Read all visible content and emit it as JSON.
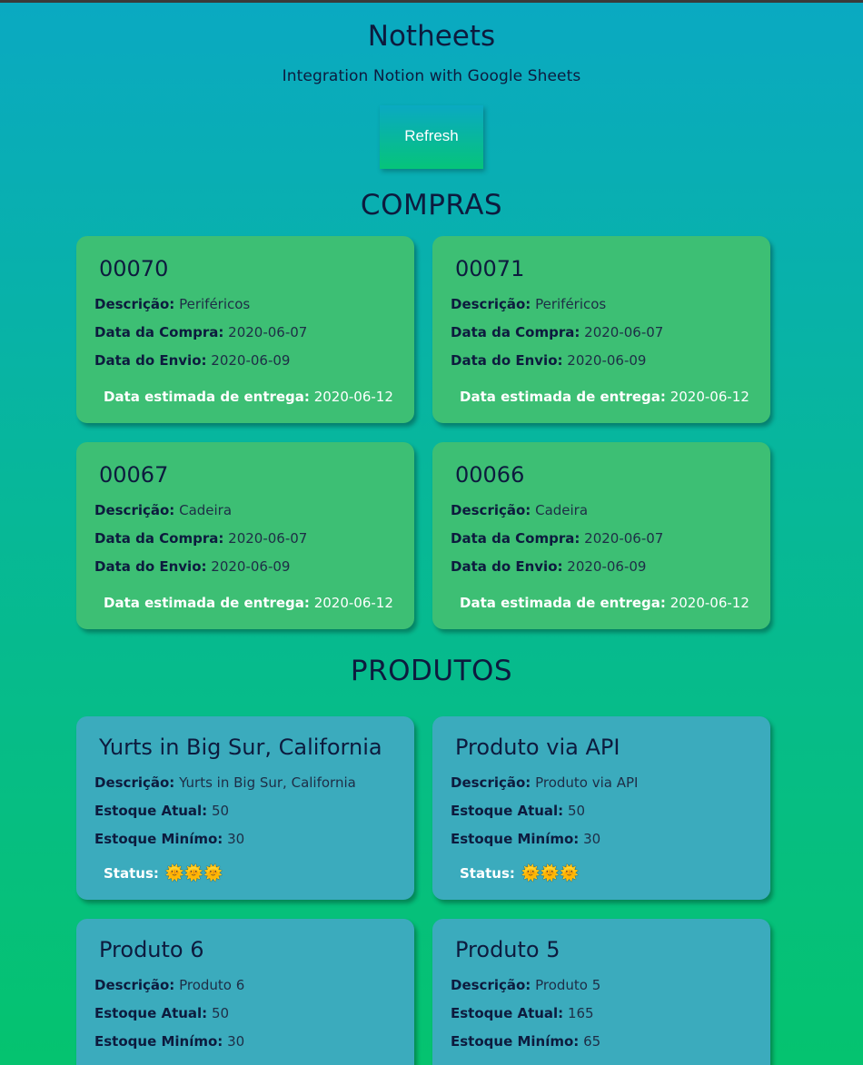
{
  "header": {
    "title": "Notheets",
    "subtitle": "Integration Notion with Google Sheets",
    "refresh_label": "Refresh"
  },
  "compras": {
    "title": "COMPRAS",
    "labels": {
      "descricao": "Descrição:",
      "data_compra": "Data da Compra:",
      "data_envio": "Data do Envio:",
      "data_entrega": "Data estimada de entrega:"
    },
    "items": [
      {
        "id": "00070",
        "descricao": "Periféricos",
        "data_compra": "2020-06-07",
        "data_envio": "2020-06-09",
        "data_entrega": "2020-06-12"
      },
      {
        "id": "00071",
        "descricao": "Periféricos",
        "data_compra": "2020-06-07",
        "data_envio": "2020-06-09",
        "data_entrega": "2020-06-12"
      },
      {
        "id": "00067",
        "descricao": "Cadeira",
        "data_compra": "2020-06-07",
        "data_envio": "2020-06-09",
        "data_entrega": "2020-06-12"
      },
      {
        "id": "00066",
        "descricao": "Cadeira",
        "data_compra": "2020-06-07",
        "data_envio": "2020-06-09",
        "data_entrega": "2020-06-12"
      }
    ]
  },
  "produtos": {
    "title": "PRODUTOS",
    "labels": {
      "descricao": "Descrição:",
      "estoque_atual": "Estoque Atual:",
      "estoque_minimo": "Estoque Minímo:",
      "status": "Status:"
    },
    "status_icon": "sun-icon",
    "items": [
      {
        "name": "Yurts in Big Sur, California",
        "descricao": "Yurts in Big Sur, California",
        "estoque_atual": "50",
        "estoque_minimo": "30",
        "status": "🌞🌞🌞"
      },
      {
        "name": "Produto via API",
        "descricao": "Produto via API",
        "estoque_atual": "50",
        "estoque_minimo": "30",
        "status": "🌞🌞🌞"
      },
      {
        "name": "Produto 6",
        "descricao": "Produto 6",
        "estoque_atual": "50",
        "estoque_minimo": "30"
      },
      {
        "name": "Produto 5",
        "descricao": "Produto 5",
        "estoque_atual": "165",
        "estoque_minimo": "65"
      }
    ]
  },
  "colors": {
    "bg_top": "#0aa9c2",
    "bg_bottom": "#05c36f",
    "compra_card": "#3dbf74",
    "produto_card": "#3babbd",
    "text": "#0d1b3e"
  }
}
